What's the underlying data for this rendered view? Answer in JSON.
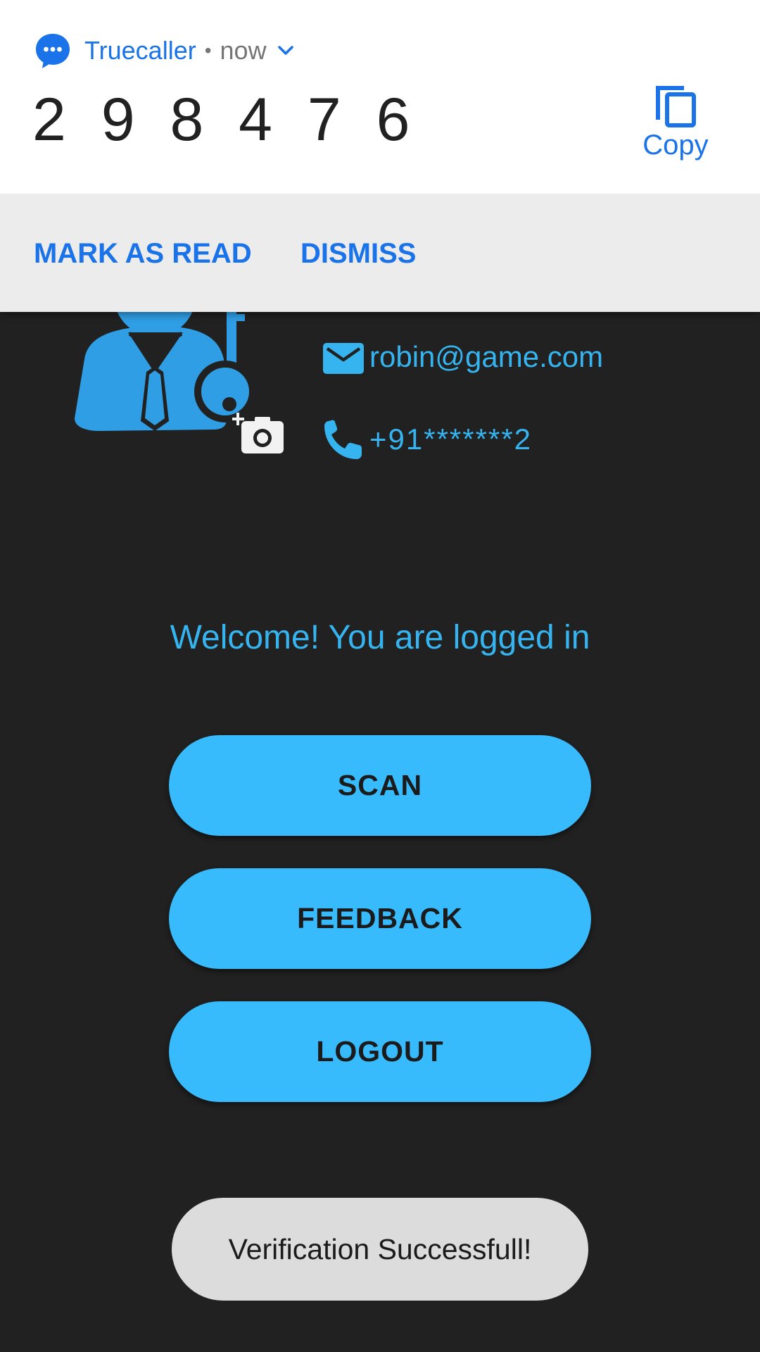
{
  "notification": {
    "app_name": "Truecaller",
    "separator": "•",
    "time": "now",
    "code": "2 9 8 4 7 6",
    "copy_label": "Copy",
    "actions": {
      "mark_as_read": "MARK AS READ",
      "dismiss": "DISMISS"
    },
    "icons": {
      "app": "chat-bubble-icon",
      "expand": "chevron-down-icon",
      "copy": "copy-icon"
    },
    "accent_color": "#1a73e8"
  },
  "profile": {
    "email": "robin@game.com",
    "phone": "+91*******2",
    "icons": {
      "avatar": "user-key-avatar-icon",
      "camera": "add-photo-icon",
      "email": "mail-icon",
      "phone": "phone-icon"
    }
  },
  "main": {
    "welcome": "Welcome! You are logged in",
    "buttons": {
      "scan": "SCAN",
      "feedback": "FEEDBACK",
      "logout": "LOGOUT"
    },
    "accent_color": "#38bbfc",
    "background_color": "#212121"
  },
  "toast": {
    "message": "Verification Successfull!"
  }
}
